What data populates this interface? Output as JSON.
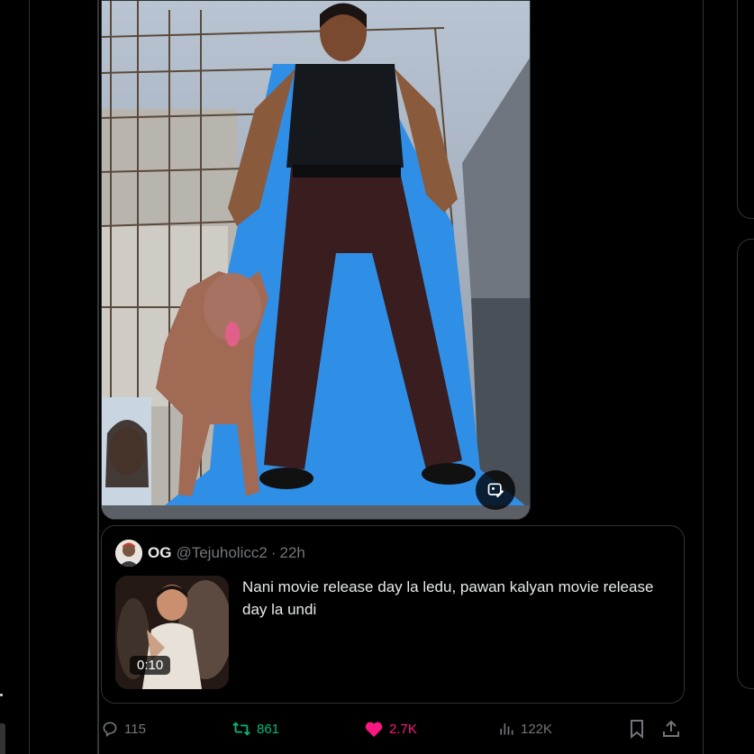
{
  "colors": {
    "background": "#000000",
    "border": "#2f3336",
    "muted": "#71767b",
    "retweet": "#00ba7c",
    "like": "#f91880",
    "text": "#e7e9ea"
  },
  "media": {
    "description_icon": "edit-image-icon"
  },
  "quote": {
    "display_name": "OG",
    "handle": "@Tejuholicc2",
    "separator": "·",
    "time": "22h",
    "text": "Nani movie release day la ledu, pawan kalyan movie release day la undi",
    "video_duration": "0:10"
  },
  "actions": {
    "replies": "115",
    "reposts": "861",
    "likes": "2.7K",
    "views": "122K",
    "icons": [
      "reply-icon",
      "repost-icon",
      "like-icon",
      "views-icon",
      "bookmark-icon",
      "share-icon"
    ]
  }
}
